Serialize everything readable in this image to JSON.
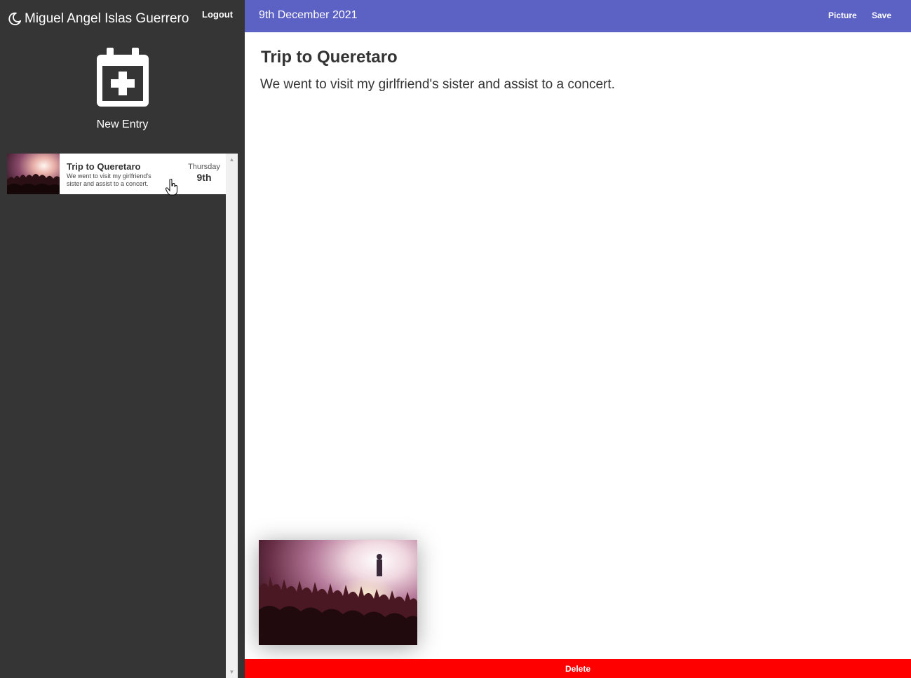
{
  "sidebar": {
    "user_name": "Miguel Angel Islas Guerrero",
    "logout_label": "Logout",
    "new_entry_label": "New Entry",
    "entries": [
      {
        "title": "Trip to Queretaro",
        "snippet": "We went to visit my girlfriend's sister and assist to a concert.",
        "weekday": "Thursday",
        "day": "9th",
        "thumbnail": "concert-crowd-image"
      }
    ]
  },
  "topbar": {
    "date": "9th December 2021",
    "picture_label": "Picture",
    "save_label": "Save",
    "accent_color": "#5c61c4"
  },
  "main": {
    "title": "Trip to Queretaro",
    "body": "We went to visit my girlfriend's sister and assist to a concert.",
    "photo": "concert-crowd-image",
    "delete_label": "Delete",
    "delete_color": "#ff0000"
  },
  "icons": {
    "theme": "moon-icon",
    "new_entry": "calendar-plus-icon"
  }
}
